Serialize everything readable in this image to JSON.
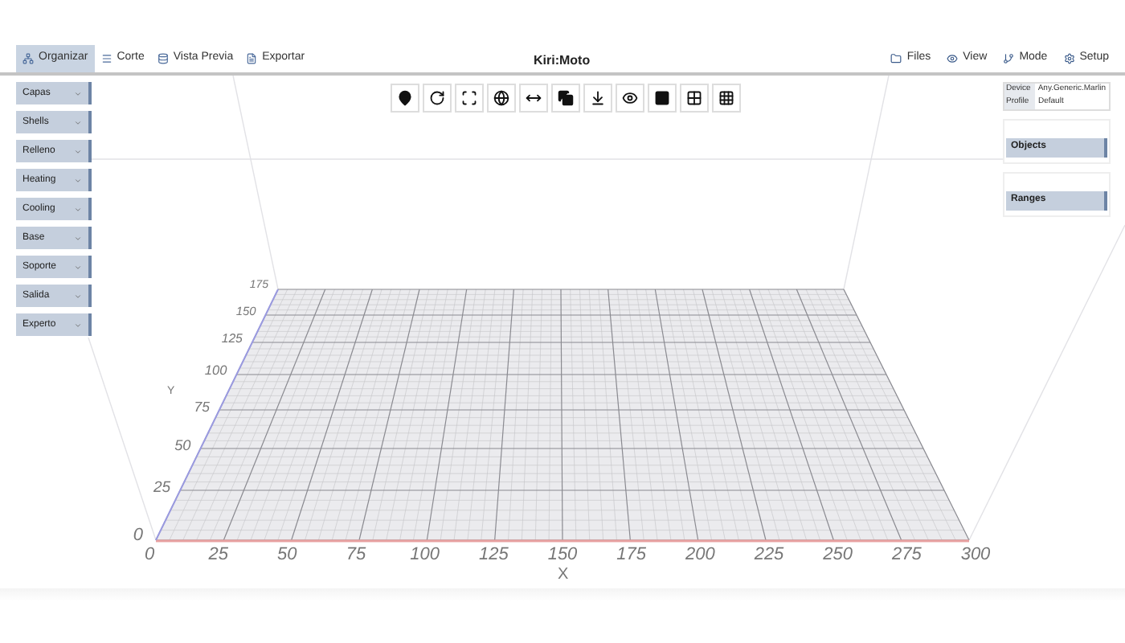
{
  "nav_tabs": [
    {
      "label": "Organizar",
      "selected": true,
      "kind": "arrange"
    },
    {
      "label": "Corte",
      "selected": false,
      "kind": "slice"
    },
    {
      "label": "Vista Previa",
      "selected": false,
      "kind": "preview"
    },
    {
      "label": "Exportar",
      "selected": false,
      "kind": "export"
    }
  ],
  "app_title": "Kiri:Moto",
  "right_menu": [
    {
      "label": "Files",
      "kind": "files"
    },
    {
      "label": "View",
      "kind": "view"
    },
    {
      "label": "Mode",
      "kind": "mode"
    },
    {
      "label": "Setup",
      "kind": "setup"
    }
  ],
  "settings_menu": [
    "Capas",
    "Shells",
    "Relleno",
    "Heating",
    "Cooling",
    "Base",
    "Soporte",
    "Salida",
    "Experto"
  ],
  "device_info": [
    {
      "label": "Device",
      "value": "Any.Generic.Marlin"
    },
    {
      "label": "Profile",
      "value": "Default"
    }
  ],
  "side_buttons": [
    "Objects",
    "Ranges"
  ],
  "viewport": {
    "x_axis_label": "X",
    "y_axis_label": "Y",
    "x_ticks": [
      "0",
      "25",
      "50",
      "75",
      "100",
      "125",
      "150",
      "175",
      "200",
      "225",
      "250",
      "275",
      "300"
    ],
    "y_ticks": [
      "0",
      "25",
      "50",
      "75",
      "100",
      "125",
      "150",
      "175"
    ]
  }
}
